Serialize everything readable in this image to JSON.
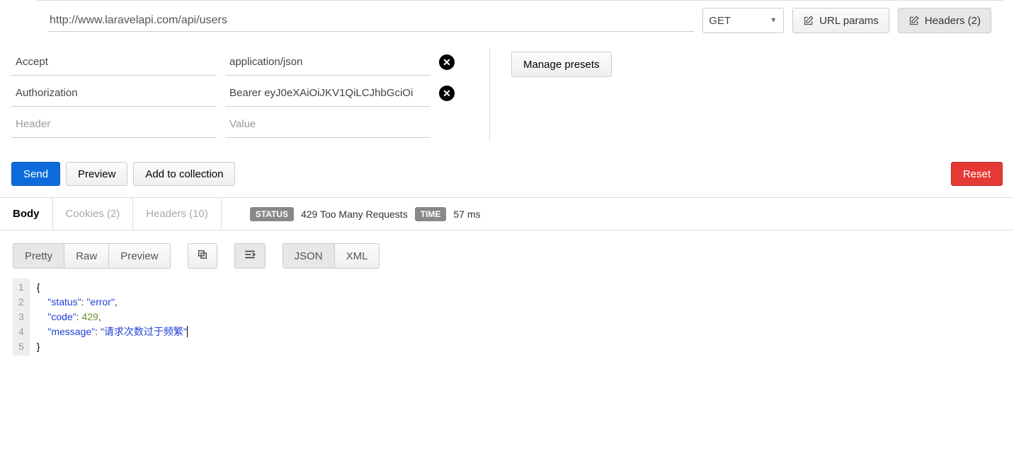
{
  "request": {
    "url": "http://www.laravelapi.com/api/users",
    "method": "GET",
    "url_params_label": "URL params",
    "headers_btn_label": "Headers (2)"
  },
  "headers": {
    "rows": [
      {
        "key": "Accept",
        "value": "application/json"
      },
      {
        "key": "Authorization",
        "value": "Bearer eyJ0eXAiOiJKV1QiLCJhbGciOi"
      }
    ],
    "key_placeholder": "Header",
    "value_placeholder": "Value",
    "manage_presets_label": "Manage presets"
  },
  "actions": {
    "send": "Send",
    "preview": "Preview",
    "add_collection": "Add to collection",
    "reset": "Reset"
  },
  "response": {
    "tabs": {
      "body": "Body",
      "cookies": "Cookies (2)",
      "headers": "Headers (10)"
    },
    "status_label": "STATUS",
    "status_text": "429 Too Many Requests",
    "time_label": "TIME",
    "time_text": "57 ms"
  },
  "viewbar": {
    "pretty": "Pretty",
    "raw": "Raw",
    "preview": "Preview",
    "json": "JSON",
    "xml": "XML"
  },
  "body_json": {
    "line1": "{",
    "line2_key": "\"status\"",
    "line2_val": "\"error\"",
    "line3_key": "\"code\"",
    "line3_val": "429",
    "line4_key": "\"message\"",
    "line4_val": "\"请求次数过于频繁\"",
    "line5": "}",
    "ln": [
      "1",
      "2",
      "3",
      "4",
      "5"
    ]
  }
}
